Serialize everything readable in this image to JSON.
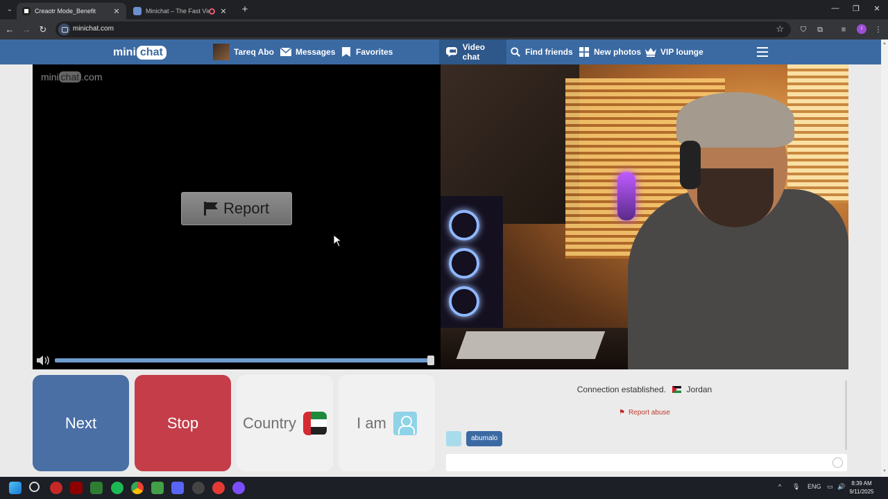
{
  "browser": {
    "tabs": [
      {
        "title": "Creaotr Mode_Benefit",
        "active": true
      },
      {
        "title": "Minichat – The Fast Video C",
        "active": false
      }
    ],
    "url": "minichat.com",
    "profile_initial": "I"
  },
  "site": {
    "logo": {
      "mini": "mini",
      "chat": "chat"
    },
    "nav": {
      "user_name": "Tareq Abo",
      "messages": "Messages",
      "favorites": "Favorites",
      "video_chat": "Video chat",
      "find_friends": "Find friends",
      "new_photos": "New photos",
      "vip_lounge": "VIP lounge"
    },
    "watermark": {
      "mini": "mini",
      "chat": "chat",
      "domain": ".com"
    },
    "report_label": "Report",
    "controls": {
      "next": "Next",
      "stop": "Stop",
      "country": "Country",
      "iam": "I am"
    },
    "chat": {
      "connection_status": "Connection established.",
      "partner_country": "Jordan",
      "report_abuse": "Report abuse",
      "partner_name": "abumalo",
      "input_value": ""
    }
  },
  "taskbar": {
    "language": "ENG",
    "time": "8:39 AM",
    "date": "9/11/2025"
  },
  "colors": {
    "nav_bg": "#3b6aa3",
    "next_bg": "#4a6fa5",
    "stop_bg": "#c43d49"
  }
}
